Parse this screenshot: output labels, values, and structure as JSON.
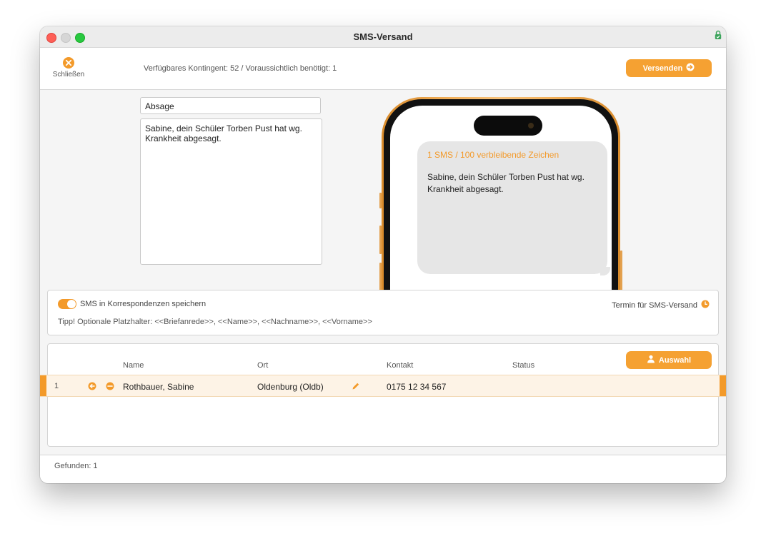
{
  "window": {
    "title": "SMS-Versand"
  },
  "toolbar": {
    "close_label": "Schließen",
    "kontingent": "Verfügbares Kontingent: 52 / Voraussichtlich benötigt: 1",
    "send_label": "Versenden"
  },
  "message": {
    "subject": "Absage",
    "body": "Sabine, dein Schüler Torben Pust hat wg. Krankheit abgesagt."
  },
  "preview": {
    "count": "1 SMS / 100 verbleibende Zeichen",
    "text": "Sabine, dein Schüler Torben Pust hat wg.\nKrankheit abgesagt."
  },
  "options": {
    "save_toggle_on": true,
    "save_label": "SMS in Korrespondenzen speichern",
    "termin_label": "Termin für SMS-Versand",
    "tip": "Tipp! Optionale Platzhalter: <<Briefanrede>>, <<Name>>, <<Nachname>>, <<Vorname>>"
  },
  "table": {
    "columns": {
      "name": "Name",
      "ort": "Ort",
      "kontakt": "Kontakt",
      "status": "Status"
    },
    "auswahl_label": "Auswahl",
    "rows": [
      {
        "num": "1",
        "name": "Rothbauer, Sabine",
        "ort": "Oldenburg (Oldb)",
        "kontakt": "0175 12 34 567",
        "status": ""
      }
    ]
  },
  "footer": {
    "found": "Gefunden: 1"
  },
  "colors": {
    "accent": "#f39a2a",
    "row_highlight": "#fdf3e6",
    "bubble": "#e6e6e6"
  },
  "icons": [
    "close-circle-icon",
    "arrow-right-circle-icon",
    "clock-icon",
    "user-add-icon",
    "arrow-left-circle-icon",
    "minus-circle-icon",
    "pencil-icon",
    "lock-icon"
  ]
}
